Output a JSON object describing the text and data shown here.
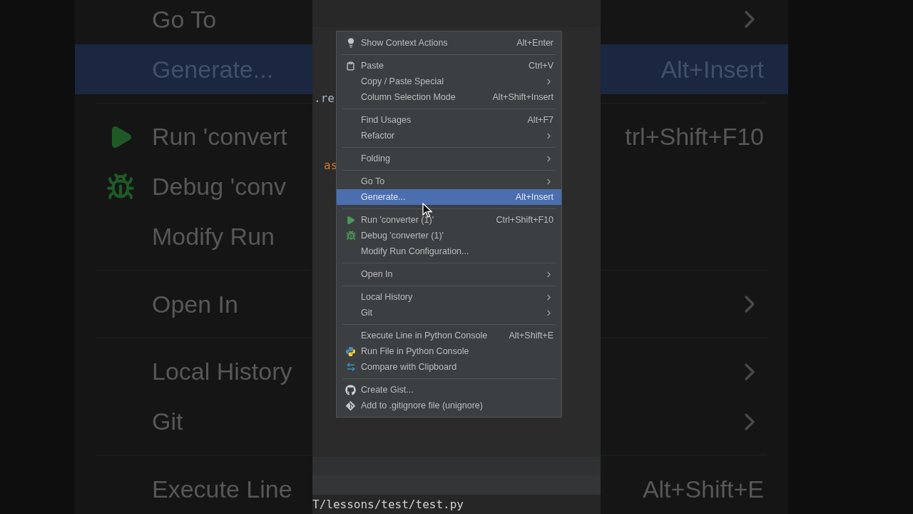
{
  "backdrop": {
    "rows": [
      {
        "kind": "item",
        "label": "Go To",
        "submenu": true,
        "selected": false
      },
      {
        "kind": "item",
        "label": "Generate...",
        "shortcut": "Alt+Insert",
        "submenu": false,
        "selected": true
      },
      {
        "kind": "separator"
      },
      {
        "kind": "item",
        "label": "Run 'convert",
        "shortcut": "trl+Shift+F10",
        "submenu": false,
        "selected": false
      },
      {
        "kind": "item",
        "label": "Debug 'conv",
        "submenu": false,
        "selected": false
      },
      {
        "kind": "item",
        "label": "Modify Run",
        "submenu": false,
        "selected": false
      },
      {
        "kind": "separator"
      },
      {
        "kind": "item",
        "label": "Open In",
        "submenu": true,
        "selected": false
      },
      {
        "kind": "separator"
      },
      {
        "kind": "item",
        "label": "Local History",
        "submenu": true,
        "selected": false
      },
      {
        "kind": "item",
        "label": "Git",
        "submenu": true,
        "selected": false
      },
      {
        "kind": "separator"
      },
      {
        "kind": "item",
        "label": "Execute Line",
        "shortcut": "Alt+Shift+E",
        "submenu": false,
        "selected": false
      }
    ]
  },
  "editor": {
    "lines": [
      {
        "text": ".re",
        "kind": "plain"
      },
      {
        "text": "as",
        "kind": "keyword"
      }
    ]
  },
  "menu": {
    "items": [
      {
        "kind": "item",
        "label": "Show Context Actions",
        "shortcut": "Alt+Enter",
        "submenu": false,
        "selected": false
      },
      {
        "kind": "separator"
      },
      {
        "kind": "item",
        "label": "Paste",
        "shortcut": "Ctrl+V",
        "submenu": false,
        "selected": false
      },
      {
        "kind": "item",
        "label": "Copy / Paste Special",
        "submenu": true,
        "selected": false
      },
      {
        "kind": "item",
        "label": "Column Selection Mode",
        "shortcut": "Alt+Shift+Insert",
        "submenu": false,
        "selected": false
      },
      {
        "kind": "separator"
      },
      {
        "kind": "item",
        "label": "Find Usages",
        "shortcut": "Alt+F7",
        "submenu": false,
        "selected": false
      },
      {
        "kind": "item",
        "label": "Refactor",
        "submenu": true,
        "selected": false
      },
      {
        "kind": "separator"
      },
      {
        "kind": "item",
        "label": "Folding",
        "submenu": true,
        "selected": false
      },
      {
        "kind": "separator"
      },
      {
        "kind": "item",
        "label": "Go To",
        "submenu": true,
        "selected": false
      },
      {
        "kind": "item",
        "label": "Generate...",
        "shortcut": "Alt+Insert",
        "submenu": false,
        "selected": true
      },
      {
        "kind": "separator"
      },
      {
        "kind": "item",
        "label": "Run 'converter (1)'",
        "shortcut": "Ctrl+Shift+F10",
        "submenu": false,
        "selected": false
      },
      {
        "kind": "item",
        "label": "Debug 'converter (1)'",
        "submenu": false,
        "selected": false
      },
      {
        "kind": "item",
        "label": "Modify Run Configuration...",
        "submenu": false,
        "selected": false
      },
      {
        "kind": "separator"
      },
      {
        "kind": "item",
        "label": "Open In",
        "submenu": true,
        "selected": false
      },
      {
        "kind": "separator"
      },
      {
        "kind": "item",
        "label": "Local History",
        "submenu": true,
        "selected": false
      },
      {
        "kind": "item",
        "label": "Git",
        "submenu": true,
        "selected": false
      },
      {
        "kind": "separator"
      },
      {
        "kind": "item",
        "label": "Execute Line in Python Console",
        "shortcut": "Alt+Shift+E",
        "submenu": false,
        "selected": false
      },
      {
        "kind": "item",
        "label": "Run File in Python Console",
        "submenu": false,
        "selected": false
      },
      {
        "kind": "item",
        "label": "Compare with Clipboard",
        "submenu": false,
        "selected": false
      },
      {
        "kind": "separator"
      },
      {
        "kind": "item",
        "label": "Create Gist...",
        "submenu": false,
        "selected": false
      },
      {
        "kind": "item",
        "label": "Add to .gitignore file (unignore)",
        "submenu": false,
        "selected": false
      }
    ]
  },
  "terminal": {
    "path": "T/lessons/test/test.py"
  }
}
